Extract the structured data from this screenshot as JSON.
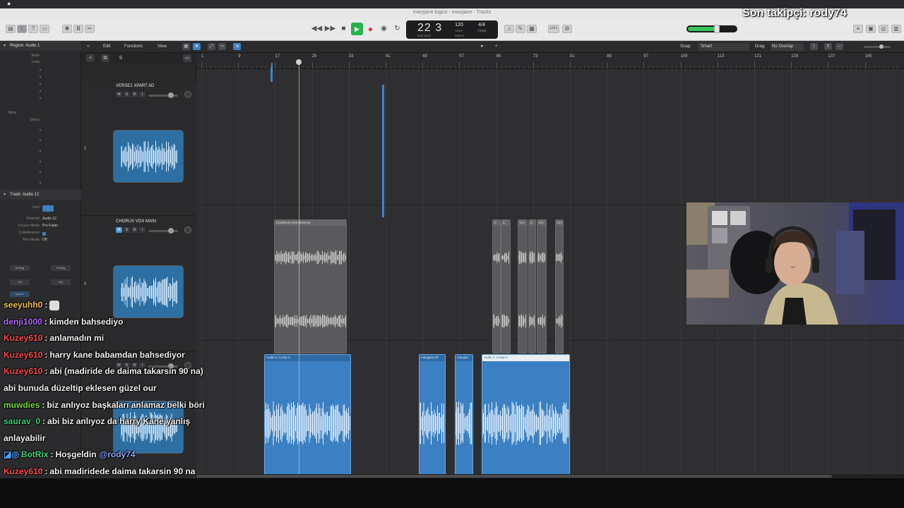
{
  "overlay": {
    "follower_text": "Son takipçi: rody74"
  },
  "window": {
    "doc_title": "maryjane.logicx - maryjane - Tracks"
  },
  "lcd": {
    "position": "22 3",
    "position_sub": "BAR   BEAT",
    "tempo": "120",
    "tempo_sub": "KEEP",
    "tempo_unit": "TEMPO",
    "timesig": "4/4",
    "key": "Cmaj"
  },
  "master_volume": {
    "level": 0.62
  },
  "inspector": {
    "region_header": "Region: Audio 1",
    "rows_top": [
      "Mute:",
      "Loop:"
    ],
    "more_label": "More",
    "delay_label": "Delay:",
    "track_header": "Track: Audio 12",
    "icon_label": "Icon:",
    "channel_label": "Channel:",
    "channel_value": "Audio 12",
    "freeze_label": "Freeze Mode:",
    "freeze_value": "Pre Fader",
    "qref_label": "Q-Reference:",
    "flex_label": "Flex Mode:",
    "flex_value": "Off",
    "setting_a": "Setting",
    "setting_b": "Setting",
    "eq_a": "EQ",
    "eq_b": "EQ",
    "input_label": "Input 1",
    "strip_a": "Audio 12",
    "strip_b": "Stereo Out"
  },
  "arrange_bar": {
    "edit": "Edit",
    "functions": "Functions",
    "view": "View",
    "snap_label": "Snap:",
    "snap_value": "Smart",
    "drag_label": "Drag:",
    "drag_value": "No Overlap"
  },
  "track_toolbar": {
    "add": "+",
    "dup": "⧉",
    "s": "S"
  },
  "ruler": {
    "bars": [
      "1",
      "9",
      "17",
      "25",
      "33",
      "41",
      "49",
      "57",
      "65",
      "73",
      "81",
      "89",
      "97",
      "105",
      "113",
      "121",
      "129",
      "137",
      "145"
    ]
  },
  "tracks": [
    {
      "name": "VERSE1 XPART AD",
      "number": "5",
      "m": "M",
      "s": "S",
      "r": "R",
      "i": "I"
    },
    {
      "name": "CHORUS VOX MAIN",
      "number": "6",
      "m": "M",
      "s": "S",
      "r": "R",
      "i": "I"
    },
    {
      "name": "",
      "number": "7",
      "m": "M",
      "s": "S",
      "r": "R",
      "i": "I"
    }
  ],
  "regions": {
    "chorus_a": "CHORUS VOX MAIN 01",
    "chorus_small": [
      "C",
      "C",
      "CH",
      "C",
      "CH",
      "CH"
    ],
    "audio_a": "Audio 1: Comp A",
    "mj_1": "maryjane.1#",
    "mj_2": "maryjan",
    "audio_b": "Audio 1: Comp A"
  },
  "chat": [
    {
      "user": "seeyuhh0",
      "color": "#f2c14e",
      "text": "",
      "emote": "skull"
    },
    {
      "user": "denji1000",
      "color": "#b36bff",
      "text": "kimden bahsediyo"
    },
    {
      "user": "Kuzey610",
      "color": "#ff4b4b",
      "text": "anlamadın mi"
    },
    {
      "user": "Kuzey610",
      "color": "#ff4b4b",
      "text": "harry kane babamdan bahsediyor"
    },
    {
      "user": "Kuzey610",
      "color": "#ff4b4b",
      "text": "abi (madiride de daima takarsin 90 na)"
    },
    {
      "user": "",
      "color": "#f2f2f2",
      "text": "abi bunuda düzeltip eklesen güzel our"
    },
    {
      "user": "muwdies",
      "color": "#7bdc3c",
      "text": "biz anlıyoz başkaları anlamaz belki böri"
    },
    {
      "user": "saurav_0",
      "color": "#3ccf7a",
      "text": "abi biz anlıyoz da harry Kane yanlış"
    },
    {
      "user": "",
      "color": "#f2f2f2",
      "text": "anlayabilir"
    },
    {
      "user": "BotRix",
      "color": "#46d17a",
      "text": "Hoşgeldin",
      "mention": "@rody74"
    },
    {
      "user": "Kuzey610",
      "color": "#ff4b4b",
      "text": "abi madiridede daima takarsin 90 na"
    },
    {
      "user": "muwdies",
      "color": "#7bdc3c",
      "text": "",
      "emote": "check"
    },
    {
      "user": "rody74",
      "color": "#4fa3ff",
      "text": "",
      "emote": "heart"
    }
  ]
}
